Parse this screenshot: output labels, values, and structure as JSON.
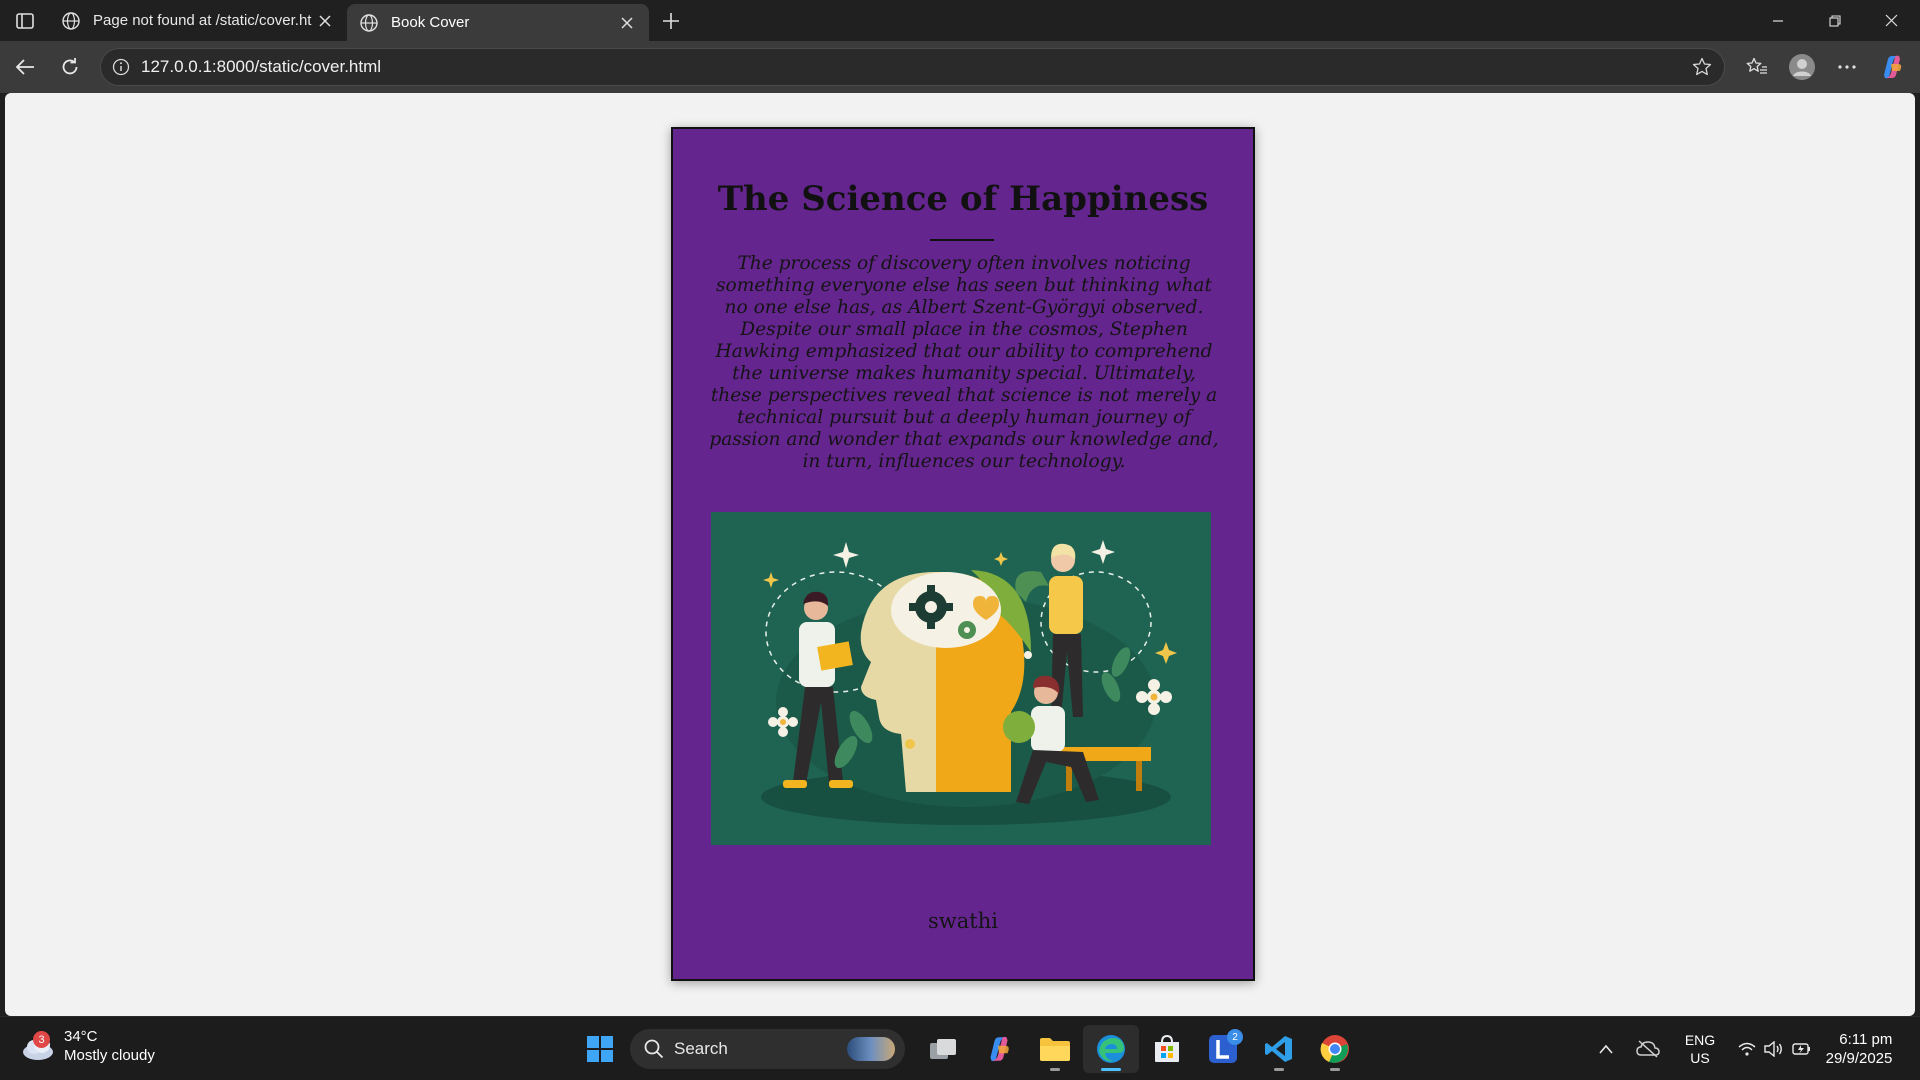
{
  "browser": {
    "tabs": [
      {
        "title": "Page not found at /static/cover.ht",
        "active": false
      },
      {
        "title": "Book Cover",
        "active": true
      }
    ],
    "address_url": "127.0.0.1:8000/static/cover.html"
  },
  "cover": {
    "title": "The Science of Happiness",
    "text": "The process of discovery often involves noticing something everyone else has seen but thinking what no one else has, as Albert Szent-Györgyi observed. Despite our small place in the cosmos, Stephen Hawking emphasized that our ability to comprehend the universe makes humanity special. Ultimately, these perspectives reveal that science is not merely a technical pursuit but a deeply human journey of passion and wonder that expands our knowledge and, in turn, influences our technology.",
    "author": "swathi",
    "colors": {
      "background": "#65258f",
      "art_background": "#1f6452"
    }
  },
  "taskbar": {
    "weather": {
      "temp": "34°C",
      "condition": "Mostly cloudy",
      "badge": "3"
    },
    "search_placeholder": "Search",
    "apps": [
      {
        "name": "task-view-icon"
      },
      {
        "name": "copilot-icon"
      },
      {
        "name": "file-explorer-icon"
      },
      {
        "name": "edge-icon",
        "active": true
      },
      {
        "name": "microsoft-store-icon"
      },
      {
        "name": "l-app-icon",
        "badge": "2"
      },
      {
        "name": "vscode-icon"
      },
      {
        "name": "chrome-icon"
      }
    ],
    "language": {
      "line1": "ENG",
      "line2": "US"
    },
    "clock": {
      "time": "6:11 pm",
      "date": "29/9/2025"
    }
  }
}
